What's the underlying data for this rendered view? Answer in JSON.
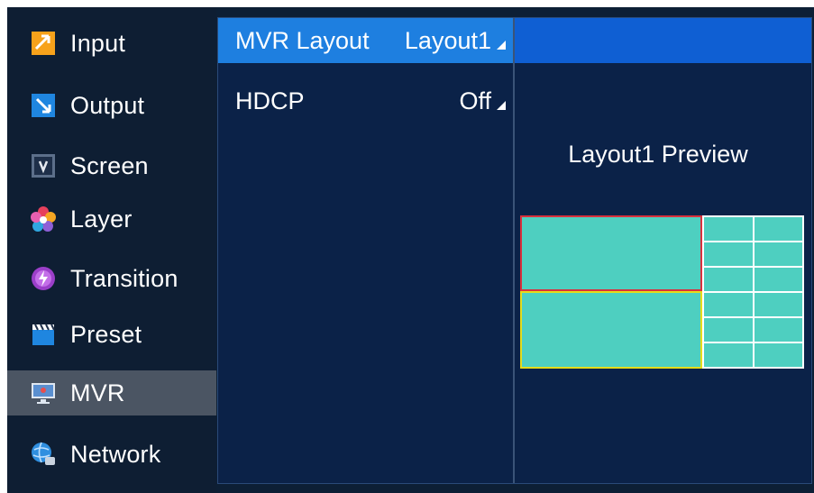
{
  "sidebar": {
    "items": [
      {
        "label": "Input",
        "icon": "input-icon"
      },
      {
        "label": "Output",
        "icon": "output-icon"
      },
      {
        "label": "Screen",
        "icon": "screen-icon"
      },
      {
        "label": "Layer",
        "icon": "layer-icon"
      },
      {
        "label": "Transition",
        "icon": "transition-icon"
      },
      {
        "label": "Preset",
        "icon": "preset-icon"
      },
      {
        "label": "MVR",
        "icon": "mvr-icon",
        "selected": true
      },
      {
        "label": "Network",
        "icon": "network-icon"
      }
    ]
  },
  "settings": {
    "mvr_layout": {
      "label": "MVR Layout",
      "value": "Layout1",
      "selected": true
    },
    "hdcp": {
      "label": "HDCP",
      "value": "Off"
    }
  },
  "preview": {
    "title": "Layout1 Preview",
    "main_border_color": "#d9313d",
    "sub_border_color": "#e5dc1a",
    "fill_color": "#4ecfc0"
  },
  "colors": {
    "background": "#0d1f35",
    "panel": "#0b2248",
    "selection": "#1e7fe0",
    "active_sidebar": "#4b5563"
  }
}
